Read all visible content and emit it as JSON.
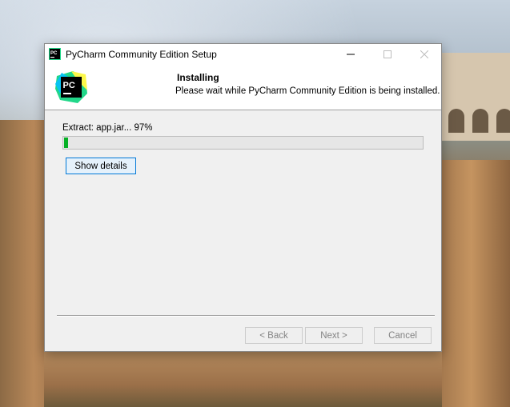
{
  "window": {
    "title": "PyCharm Community Edition Setup",
    "minimize_icon": "minimize-icon",
    "maximize_icon": "maximize-icon",
    "close_icon": "close-icon"
  },
  "header": {
    "title": "Installing",
    "subtitle": "Please wait while PyCharm Community Edition is being installed.",
    "logo_text": "PC"
  },
  "progress": {
    "status": "Extract: app.jar... 97%",
    "fraction": 0.012
  },
  "buttons": {
    "show_details": "Show details",
    "back": "< Back",
    "next": "Next >",
    "cancel": "Cancel"
  },
  "colors": {
    "progress_fill": "#06b025",
    "accent_border": "#0078d7"
  }
}
